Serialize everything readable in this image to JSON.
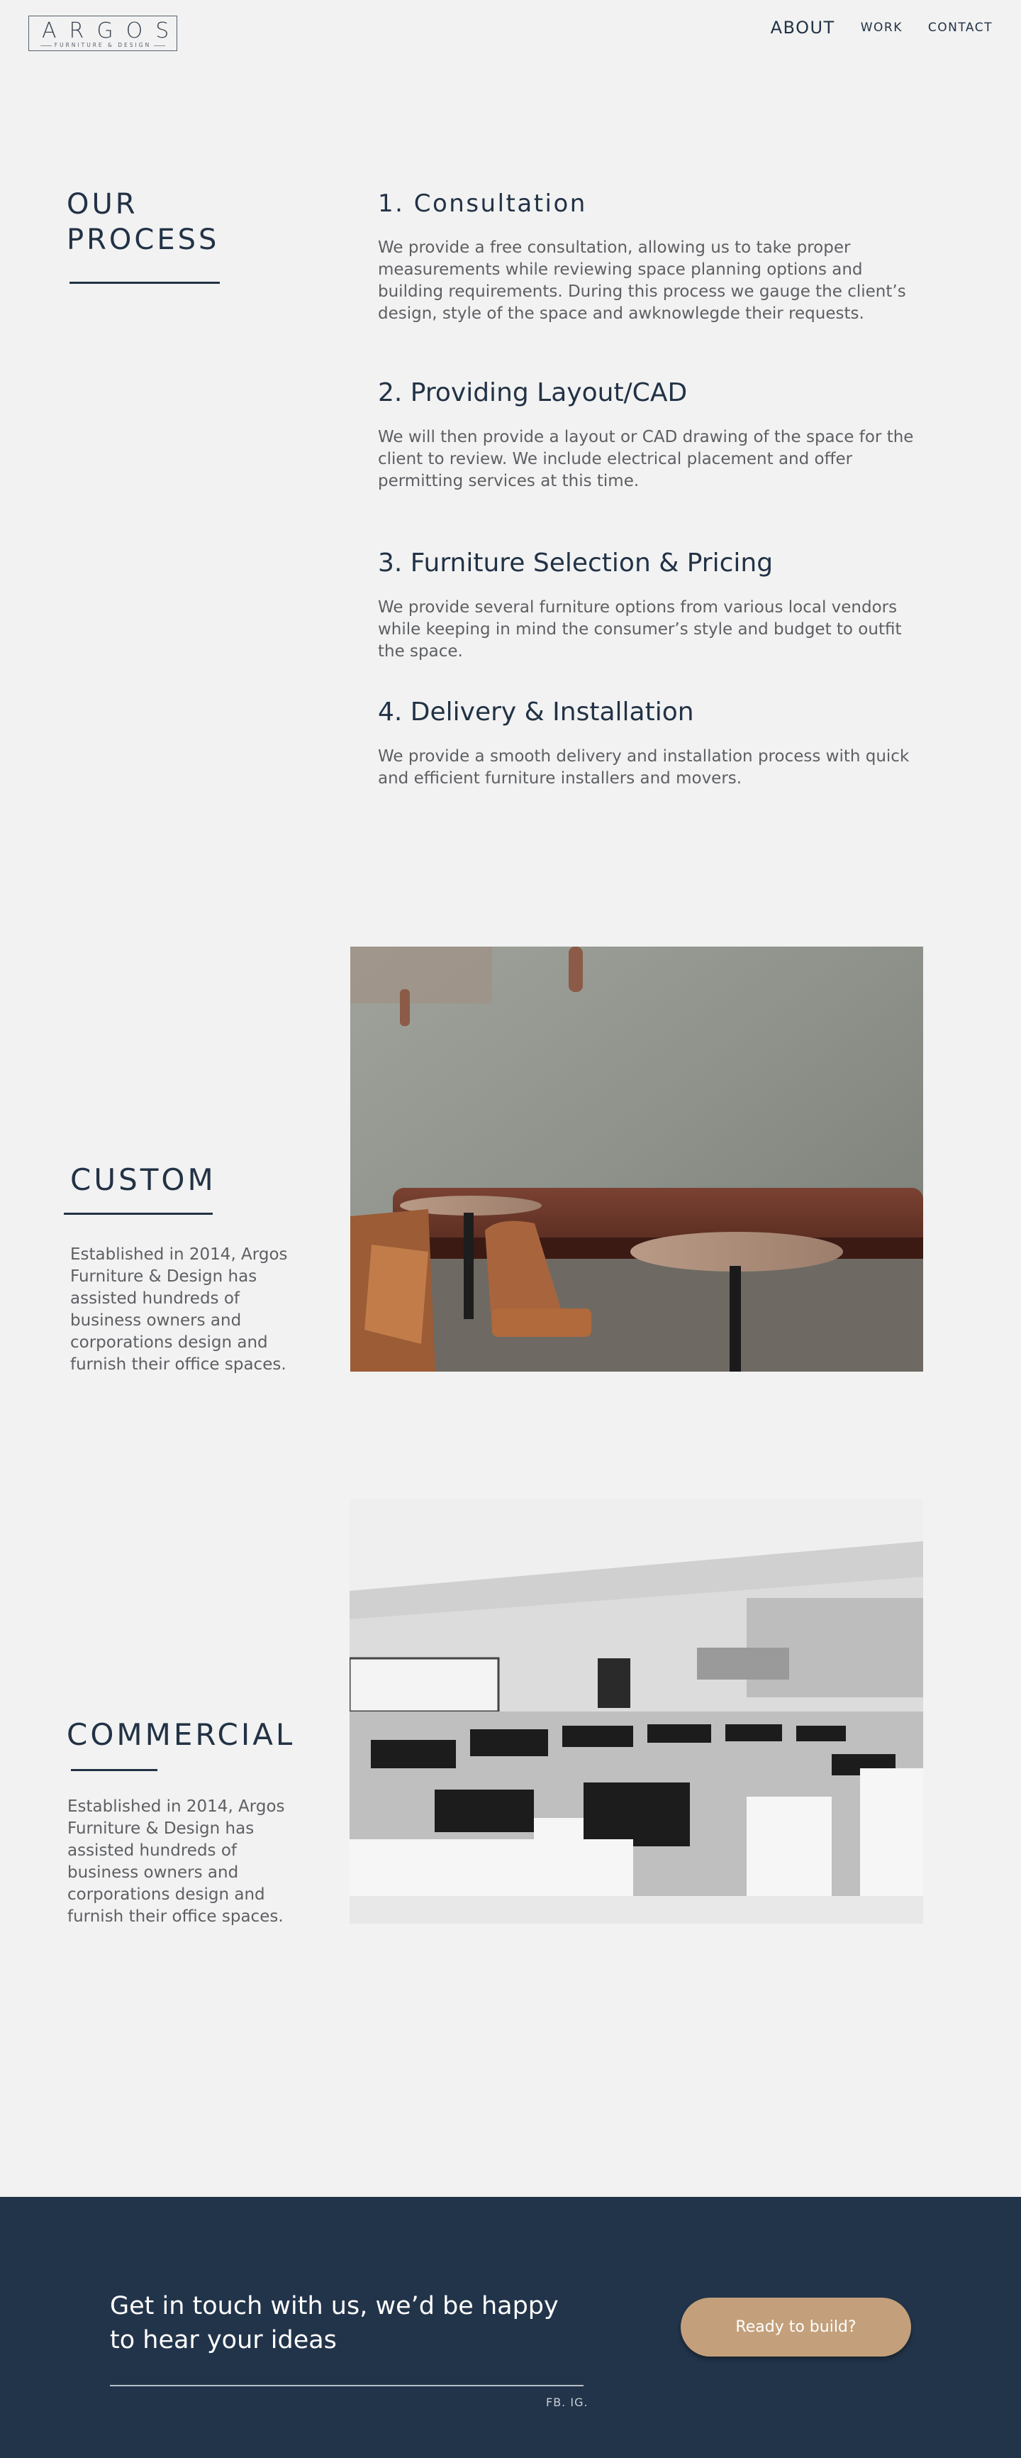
{
  "brand": {
    "name": "ARGOS",
    "tagline": "FURNITURE & DESIGN"
  },
  "nav": {
    "about": "ABOUT",
    "work": "WORK",
    "contact": "CONTACT"
  },
  "process": {
    "title": "OUR\nPROCESS",
    "steps": [
      {
        "title": "1. Consultation",
        "text": "We provide a free consultation, allowing us to take proper measurements while reviewing space planning options and building requirements. During this process we gauge the client’s design, style of the space and awknowlegde their requests."
      },
      {
        "title": "2. Providing Layout/CAD",
        "text": "We will then provide a layout or CAD drawing of the space for the client to review. We include electrical placement and offer permitting services at this time."
      },
      {
        "title": "3. Furniture Selection & Pricing",
        "text": "We provide several furniture options from various local vendors while keeping in mind the consumer’s style and budget to outfit the space."
      },
      {
        "title": "4. Delivery & Installation",
        "text": "We provide a smooth delivery and installation process with quick and efficient furniture installers and movers."
      }
    ]
  },
  "custom": {
    "title": "CUSTOM",
    "text": "Established in 2014, Argos Furniture & Design has assisted hundreds of business owners and corporations design and furnish their office spaces."
  },
  "commercial": {
    "title": "COMMERCIAL",
    "text": "Established in 2014, Argos Furniture & Design has assisted hundreds of business owners and corporations design and furnish their office spaces."
  },
  "footer": {
    "text": "Get in touch with us, we’d be happy to hear your ideas",
    "social": "FB. IG.",
    "cta": "Ready to build?"
  },
  "colors": {
    "navy": "#223246",
    "background": "#f2f2f2",
    "accent": "#c3a07b",
    "body_text": "#5d5f63"
  }
}
